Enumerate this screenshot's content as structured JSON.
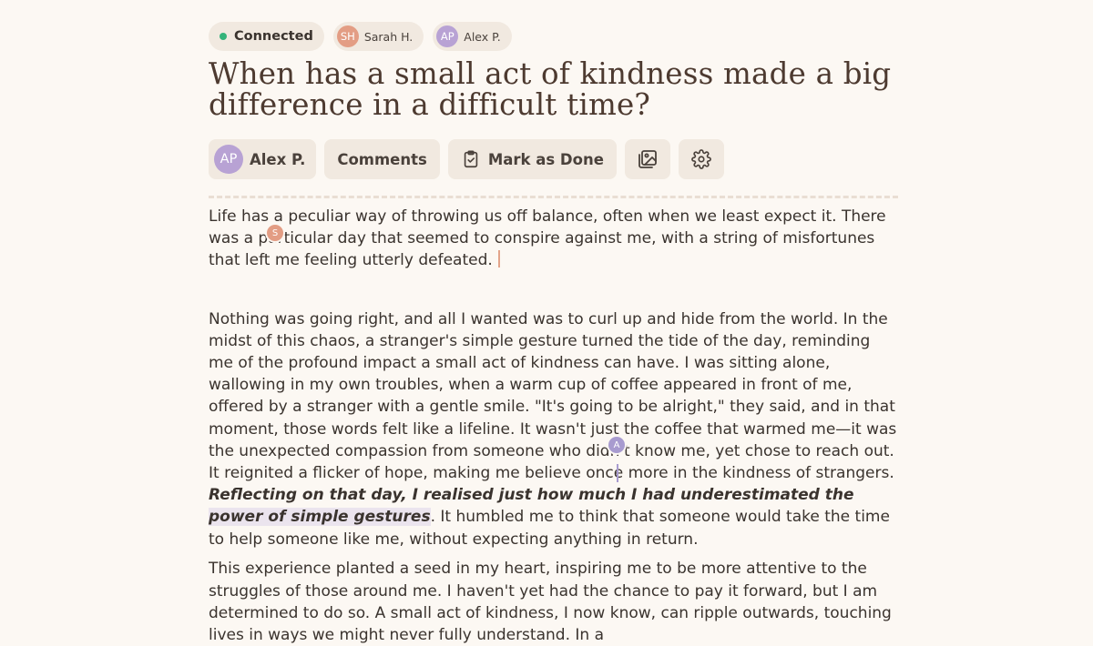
{
  "presence": {
    "status": "Connected",
    "users": [
      {
        "initials": "SH",
        "name": "Sarah H.",
        "color": "#e39d84"
      },
      {
        "initials": "AP",
        "name": "Alex P.",
        "color": "#b8a2d4"
      }
    ]
  },
  "title": "When has a small act of kindness made a big difference in a difficult time?",
  "toolbar": {
    "user_initials": "AP",
    "user_name": "Alex P.",
    "comments_label": "Comments",
    "mark_done_label": "Mark as Done",
    "gallery_icon": "images-icon",
    "settings_icon": "gear-icon"
  },
  "cursors": {
    "sarah_initial": "S",
    "alex_initial": "A"
  },
  "body": {
    "p1": "Life has a peculiar way of throwing us off balance, often when we least expect it. There was a particular day that seemed to conspire against me, with a string of misfortunes that left me feeling utterly defeated.",
    "p2_a": "Nothing was going right, and all I wanted was to curl up and hide from the world. In the midst of this chaos, a stranger's simple gesture turned the tide of the day, reminding me of the profound impact a small act of kindness can have. I was sitting alone, wallowing in my own troubles, when a warm cup of coffee appeared in front of me, offered by a stranger with a gentle smile. \"It's going to be alright,\" they said, and in that moment, those words felt like a lifeline. It wasn't just the coffee that warmed me—it was the unexpected compassion from someone who didn't know me, yet chose to reach out. It reignited a flicker of hope, making me believe once more in the kindness of strangers. ",
    "p2_bold": "Reflecting on that day, I realised just how much I had underestimated the ",
    "p2_highlight": "power of simple gestures",
    "p2_b": ". It humbled me to think that someone would take the time to help someone like me, without expecting anything in return.",
    "p3": "This experience planted a seed in my heart, inspiring me to be more attentive to the struggles of those around me. I haven't yet had the chance to pay it forward, but I am determined to do so. A small act of kindness, I now know, can ripple outwards, touching lives in ways we might never fully understand. In a"
  }
}
